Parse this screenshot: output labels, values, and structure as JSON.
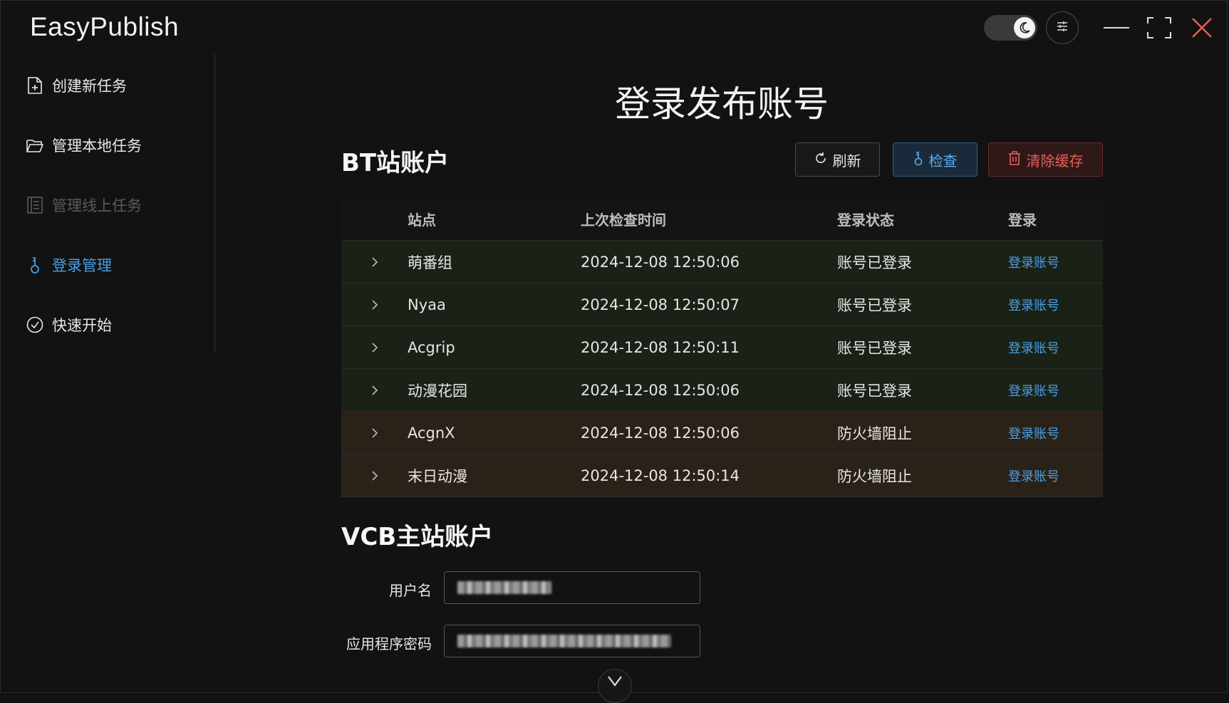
{
  "app": {
    "title": "EasyPublish"
  },
  "sidebar": {
    "items": [
      {
        "label": "创建新任务",
        "icon": "file-plus-icon"
      },
      {
        "label": "管理本地任务",
        "icon": "folder-icon"
      },
      {
        "label": "管理线上任务",
        "icon": "list-icon"
      },
      {
        "label": "登录管理",
        "icon": "key-icon"
      },
      {
        "label": "快速开始",
        "icon": "check-circle-icon"
      }
    ],
    "active_index": 3,
    "disabled_index": 2
  },
  "main": {
    "title": "登录发布账号",
    "bt_section": {
      "title": "BT站账户",
      "buttons": {
        "refresh": "刷新",
        "check": "检查",
        "clear_cache": "清除缓存"
      },
      "columns": [
        "站点",
        "上次检查时间",
        "登录状态",
        "登录"
      ],
      "rows": [
        {
          "site": "萌番组",
          "time": "2024-12-08 12:50:06",
          "status": "账号已登录",
          "action": "登录账号",
          "state": "ok"
        },
        {
          "site": "Nyaa",
          "time": "2024-12-08 12:50:07",
          "status": "账号已登录",
          "action": "登录账号",
          "state": "ok"
        },
        {
          "site": "Acgrip",
          "time": "2024-12-08 12:50:11",
          "status": "账号已登录",
          "action": "登录账号",
          "state": "ok"
        },
        {
          "site": "动漫花园",
          "time": "2024-12-08 12:50:06",
          "status": "账号已登录",
          "action": "登录账号",
          "state": "ok"
        },
        {
          "site": "AcgnX",
          "time": "2024-12-08 12:50:06",
          "status": "防火墙阻止",
          "action": "登录账号",
          "state": "warn"
        },
        {
          "site": "末日动漫",
          "time": "2024-12-08 12:50:14",
          "status": "防火墙阻止",
          "action": "登录账号",
          "state": "warn"
        }
      ]
    },
    "vcb_section": {
      "title": "VCB主站账户",
      "username_label": "用户名",
      "password_label": "应用程序密码"
    }
  },
  "colors": {
    "accent": "#4a9fe6",
    "danger": "#e8605a",
    "ok_row": "#1a2218",
    "warn_row": "#2a2219"
  }
}
